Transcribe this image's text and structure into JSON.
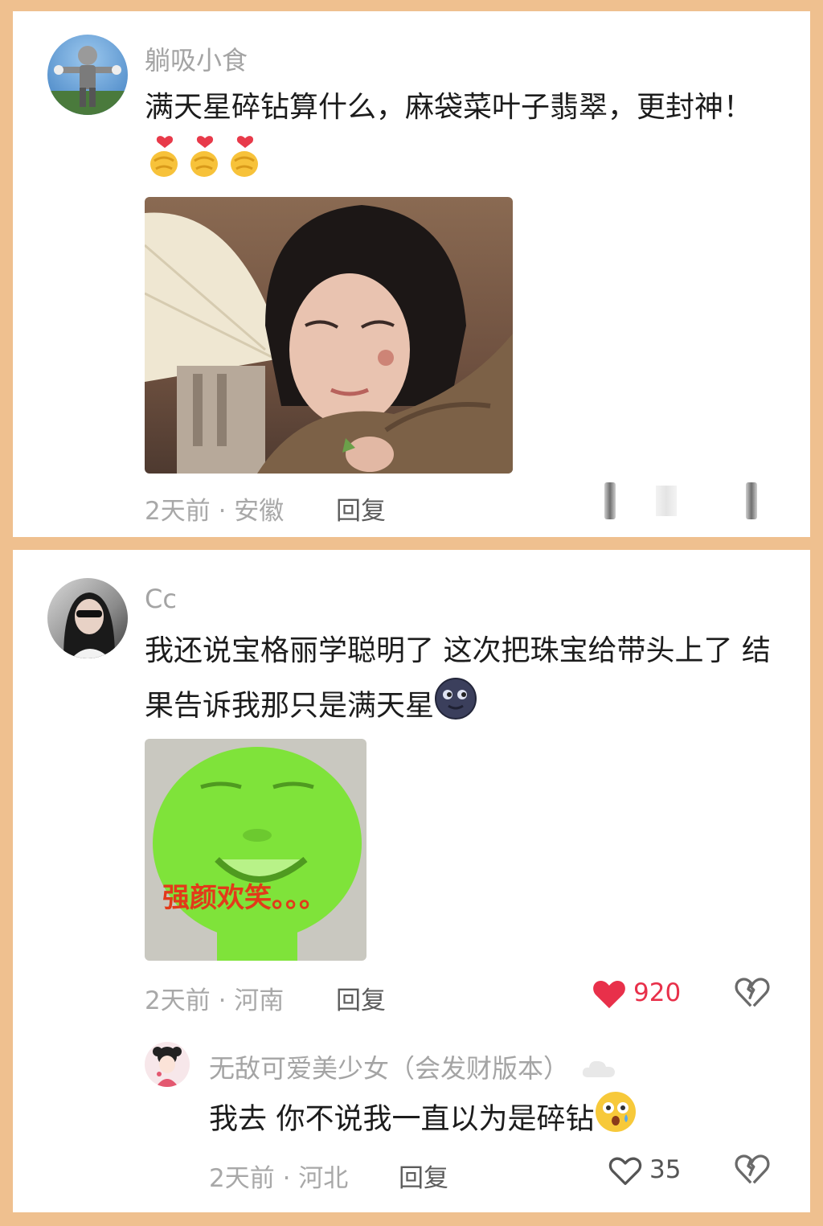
{
  "comments": [
    {
      "username": "躺吸小食",
      "text": "满天星碎钻算什么，麻袋菜叶子翡翠，更封神！",
      "emojis": [
        "finger-heart-icon",
        "finger-heart-icon",
        "finger-heart-icon"
      ],
      "image": "woman-in-burlap-cloak-photo",
      "time": "2天前",
      "location": "安徽",
      "reply_label": "回复"
    },
    {
      "username": "Cc",
      "text": "我还说宝格丽学聪明了 这次把珠宝给带头上了 结果告诉我那只是满天星",
      "emojis": [
        "new-moon-face-icon"
      ],
      "image": "green-face-meme",
      "image_caption": "强颜欢笑。。。",
      "time": "2天前",
      "location": "河南",
      "reply_label": "回复",
      "likes": "920",
      "liked": true,
      "replies": [
        {
          "username": "无敌可爱美少女（会发财版本）",
          "text": "我去 你不说我一直以为是碎钻",
          "emojis": [
            "dizzy-face-icon"
          ],
          "time": "2天前",
          "location": "河北",
          "reply_label": "回复",
          "likes": "35",
          "liked": false
        }
      ]
    }
  ],
  "colors": {
    "background": "#efc08f",
    "card": "#ffffff",
    "like_red": "#e8304a",
    "muted_text": "#a8a8a8"
  }
}
